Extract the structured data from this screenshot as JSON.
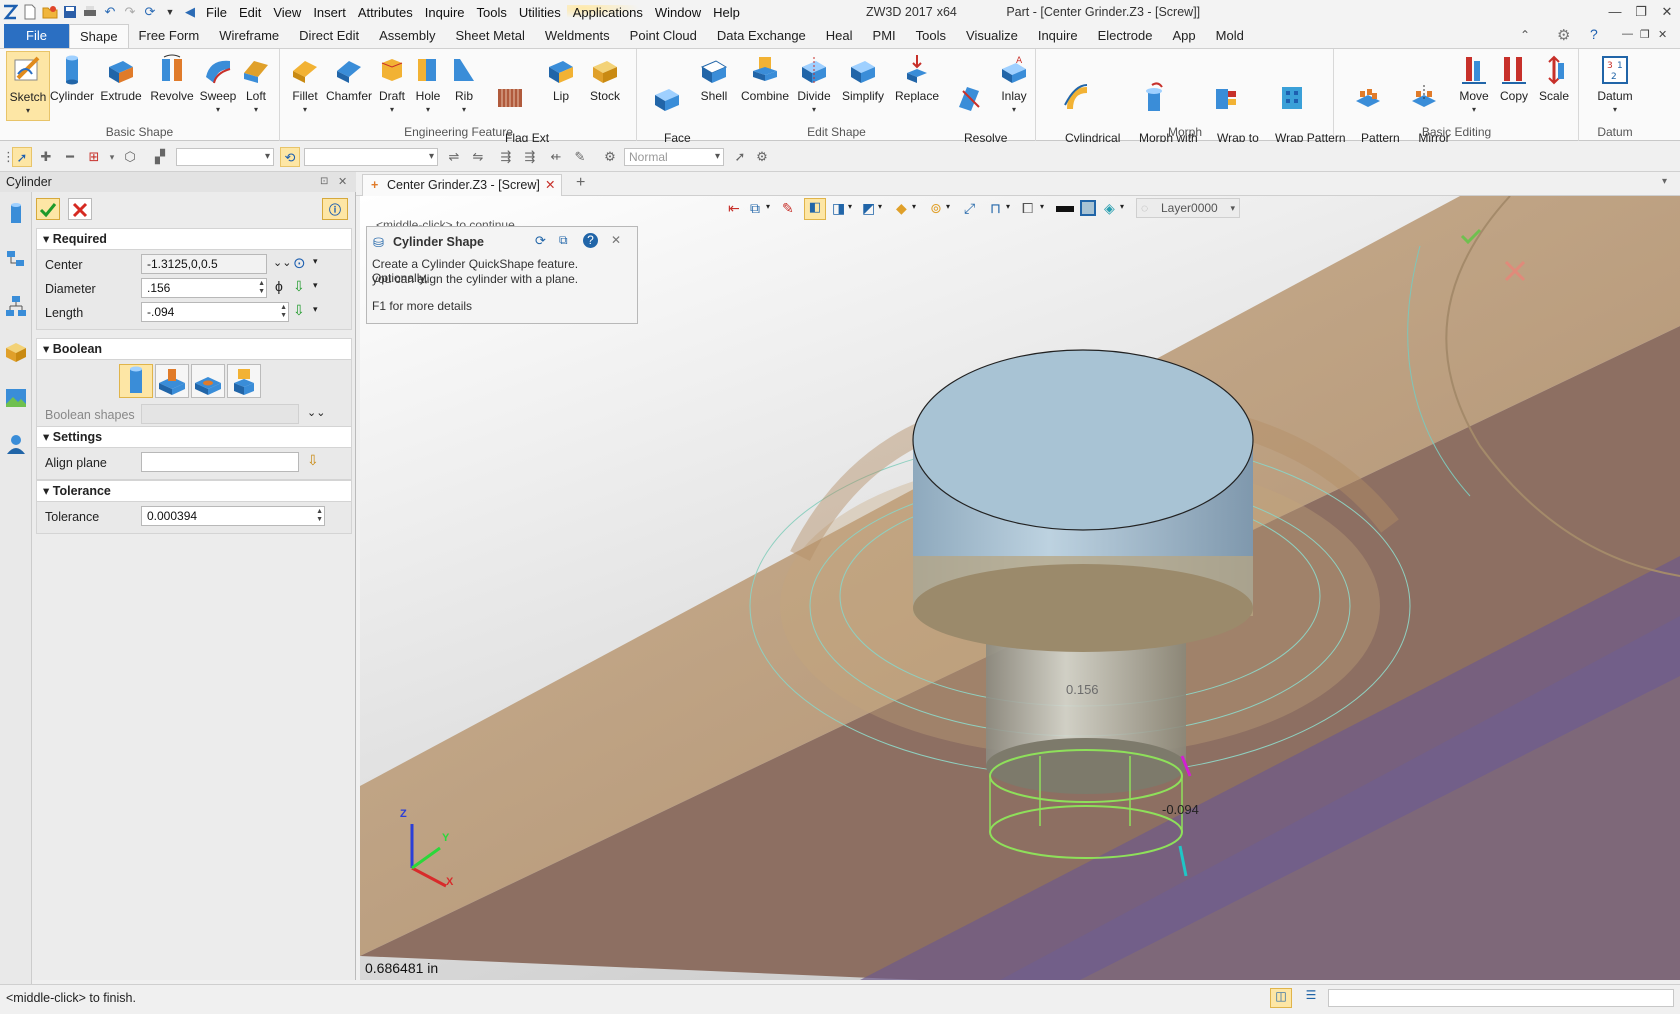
{
  "app": {
    "product": "ZW3D 2017",
    "arch": "x64",
    "doc_title": "Part - [Center Grinder.Z3 - [Screw]]"
  },
  "menu": [
    "File",
    "Edit",
    "View",
    "Insert",
    "Attributes",
    "Inquire",
    "Tools",
    "Utilities",
    "Applications",
    "Window",
    "Help"
  ],
  "ribbon_tabs": [
    "File",
    "Shape",
    "Free Form",
    "Wireframe",
    "Direct Edit",
    "Assembly",
    "Sheet Metal",
    "Weldments",
    "Point Cloud",
    "Data Exchange",
    "Heal",
    "PMI",
    "Tools",
    "Visualize",
    "Inquire",
    "Electrode",
    "App",
    "Mold"
  ],
  "ribbon_groups": {
    "basic_shape": {
      "label": "Basic Shape",
      "buttons": [
        "Sketch",
        "Cylinder",
        "Extrude",
        "Revolve",
        "Sweep",
        "Loft"
      ]
    },
    "engineering_feature": {
      "label": "Engineering Feature",
      "buttons": [
        "Fillet",
        "Chamfer",
        "Draft",
        "Hole",
        "Rib",
        "Flag Ext\nThread",
        "Lip",
        "Stock"
      ]
    },
    "edit_shape": {
      "label": "Edit Shape",
      "buttons": [
        "Face\nOffset",
        "Shell",
        "Combine",
        "Divide",
        "Simplify",
        "Replace",
        "Resolve\nSelfX",
        "Inlay"
      ]
    },
    "morph": {
      "label": "Morph",
      "buttons": [
        "Cylindrical\nBend",
        "Morph with\nPoint",
        "Wrap to\nFaces",
        "Wrap Pattern\nto Faces"
      ]
    },
    "basic_editing": {
      "label": "Basic Editing",
      "buttons": [
        "Pattern\nFeature",
        "Mirror\nFeature",
        "Move",
        "Copy",
        "Scale"
      ]
    },
    "datum": {
      "label": "Datum",
      "buttons": [
        "Datum"
      ]
    }
  },
  "toolbar2": {
    "render_mode": "Normal"
  },
  "panel": {
    "title": "Cylinder",
    "sections": {
      "required": "Required",
      "boolean": "Boolean",
      "settings": "Settings",
      "tolerance": "Tolerance"
    },
    "fields": {
      "center_label": "Center",
      "center_value": "-1.3125,0,0.5",
      "diameter_label": "Diameter",
      "diameter_value": ".156",
      "length_label": "Length",
      "length_value": "-.094",
      "boolean_shapes_label": "Boolean shapes",
      "align_plane_label": "Align plane",
      "tolerance_label": "Tolerance",
      "tolerance_value": "0.000394"
    }
  },
  "doc_tab": "Center Grinder.Z3 - [Screw]",
  "layer": "Layer0000",
  "tooltip": {
    "hint_behind": "<middle-click> to continue.",
    "title": "Cylinder Shape",
    "line1": "Create a Cylinder QuickShape feature.  Optionally,",
    "line2": "you can align the cylinder with a plane.",
    "line3": "F1 for more details"
  },
  "viewport": {
    "dim_diameter": "0.156",
    "dim_length": "-0.094",
    "measure": "0.686481 in",
    "axis_x": "X",
    "axis_y": "Y",
    "axis_z": "Z"
  },
  "status": {
    "text": "<middle-click> to finish."
  }
}
